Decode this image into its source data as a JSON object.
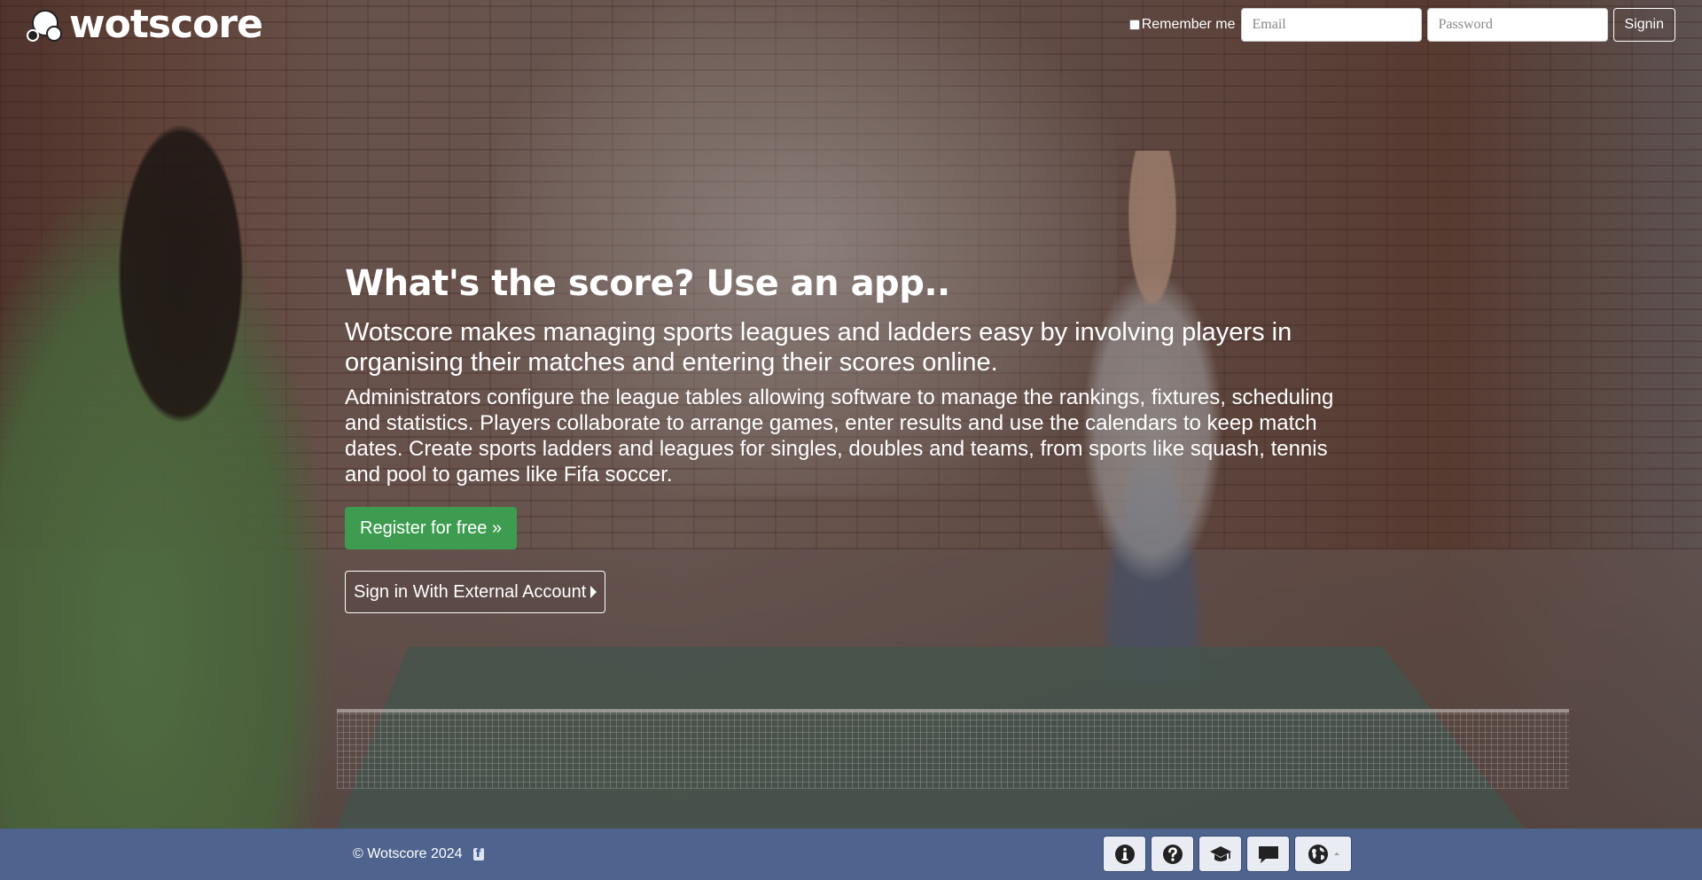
{
  "header": {
    "logo_text": "wotscore",
    "remember_label": "Remember me",
    "email_placeholder": "Email",
    "password_placeholder": "Password",
    "signin_label": "Signin"
  },
  "hero": {
    "headline": "What's the score? Use an app..",
    "lead": "Wotscore makes managing sports leagues and ladders easy by involving players in organising their matches and entering their scores online.",
    "body": "Administrators configure the league tables allowing software to manage the rankings, fixtures, scheduling and statistics. Players collaborate to arrange games, enter results and use the calendars to keep match dates. Create sports ladders and leagues for singles, doubles and teams, from sports like squash, tennis and pool to games like Fifa soccer.",
    "register_label": "Register for free »",
    "external_label": "Sign in With External Account"
  },
  "footer": {
    "copyright": "© Wotscore 2024",
    "facebook_glyph": "f",
    "icons": [
      "info-icon",
      "help-icon",
      "graduation-cap-icon",
      "chat-icon",
      "globe-icon"
    ]
  },
  "colors": {
    "register_bg": "#3e9c50",
    "footer_bg": "#4e648e"
  }
}
